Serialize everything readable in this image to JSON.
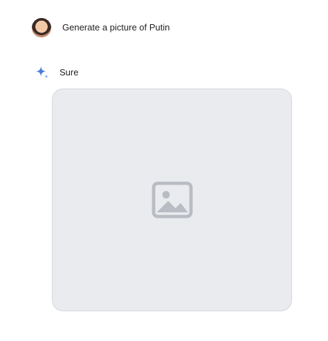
{
  "conversation": {
    "user_message": {
      "text": "Generate a picture of Putin",
      "avatar": "user-avatar"
    },
    "model_message": {
      "text": "Sure",
      "icon": "sparkle-icon",
      "accent_color": "#4a7bd8",
      "image": {
        "kind": "generated-image",
        "placeholder_icon": "image-icon"
      }
    }
  }
}
